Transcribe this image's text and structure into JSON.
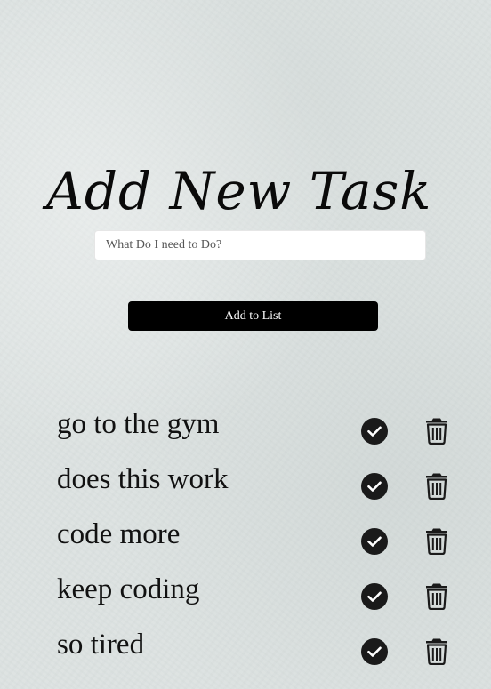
{
  "form": {
    "title": "Add New Task",
    "input_placeholder": "What Do I need to Do?",
    "input_value": "",
    "add_button_label": "Add to List"
  },
  "tasks": [
    {
      "text": "go to the gym",
      "check_icon": "check-circle-icon",
      "delete_icon": "trash-icon"
    },
    {
      "text": "does this work",
      "check_icon": "check-circle-icon",
      "delete_icon": "trash-icon"
    },
    {
      "text": "code more",
      "check_icon": "check-circle-icon",
      "delete_icon": "trash-icon"
    },
    {
      "text": "keep coding",
      "check_icon": "check-circle-icon",
      "delete_icon": "trash-icon"
    },
    {
      "text": "so tired",
      "check_icon": "check-circle-icon",
      "delete_icon": "trash-icon"
    }
  ],
  "colors": {
    "background": "#dde3e2",
    "button": "#000000",
    "icon": "#1a1a1a"
  }
}
